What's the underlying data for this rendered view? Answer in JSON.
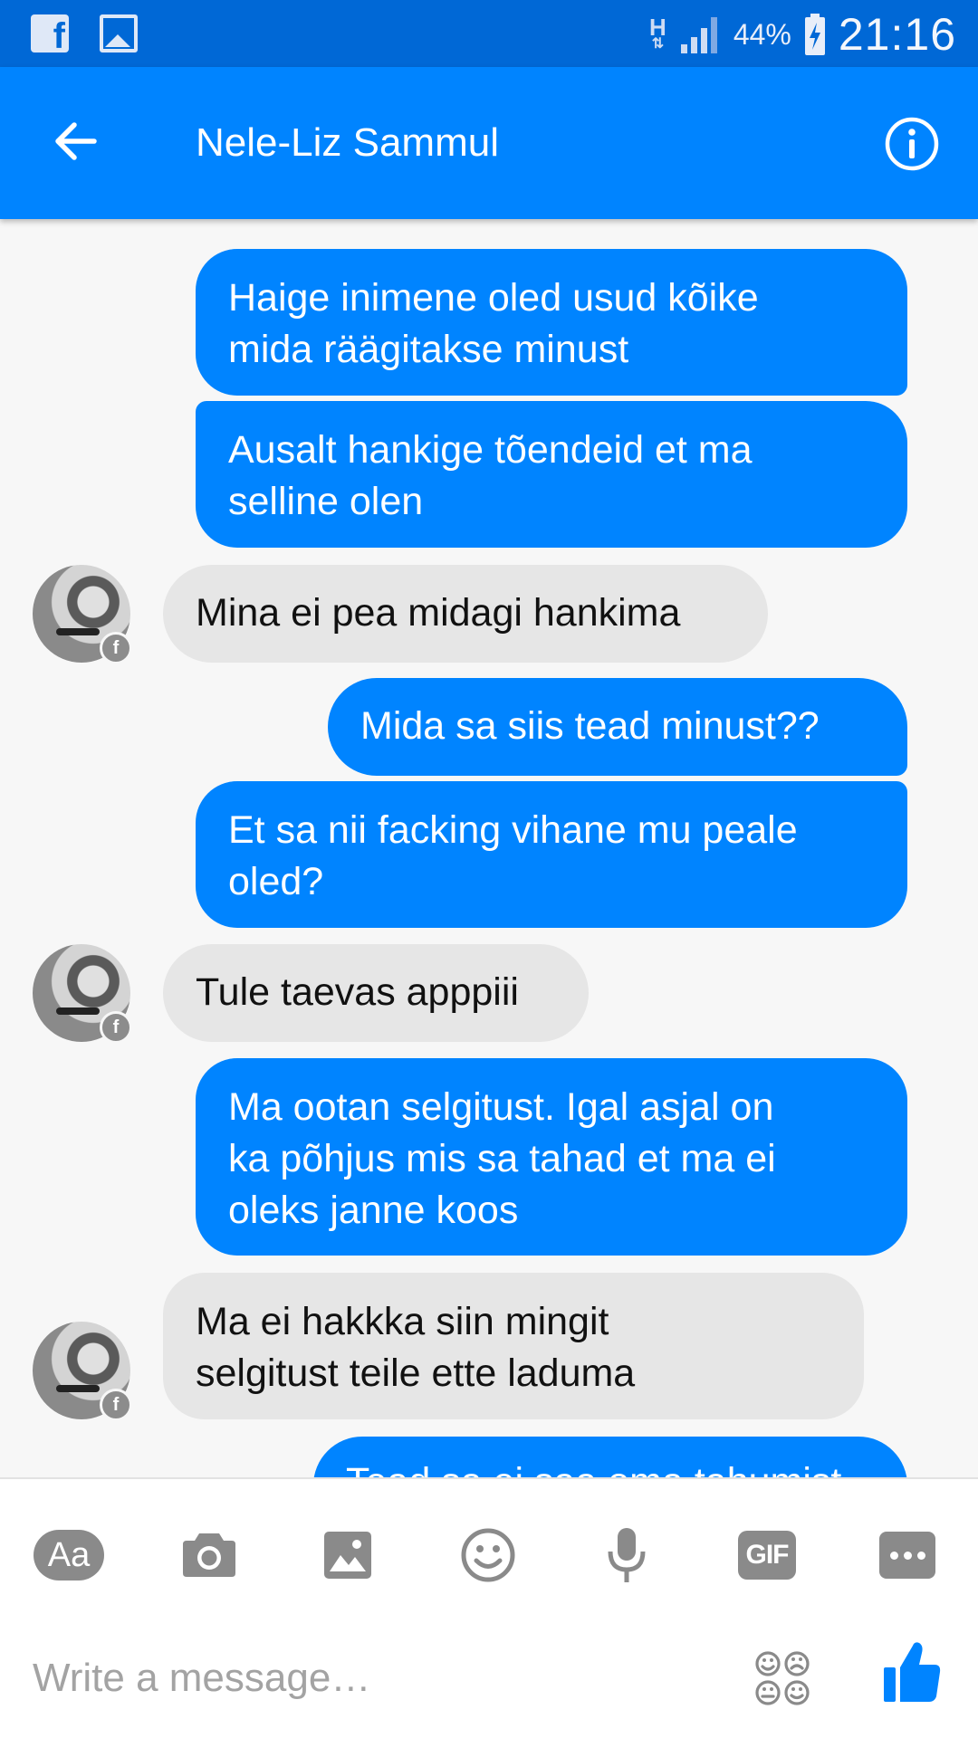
{
  "status_bar": {
    "network_type": "H",
    "battery_percent": "44%",
    "time": "21:16",
    "icons": [
      "facebook-notification-icon",
      "gallery-notification-icon",
      "network-h-icon",
      "signal-icon",
      "battery-charging-icon"
    ]
  },
  "header": {
    "title": "Nele-Liz Sammul",
    "back_icon": "arrow-left-icon",
    "info_icon": "info-circle-icon"
  },
  "messages": [
    {
      "direction": "outgoing",
      "text_lines": [
        "Haige inimene oled usud kõike",
        "mida räägitakse minust"
      ]
    },
    {
      "direction": "outgoing",
      "text_lines": [
        "Ausalt hankige tõendeid et ma",
        "selline olen"
      ]
    },
    {
      "direction": "incoming",
      "text_lines": [
        "Mina ei pea midagi hankima"
      ]
    },
    {
      "direction": "outgoing",
      "text_lines": [
        "Mida sa siis tead minust??"
      ]
    },
    {
      "direction": "outgoing",
      "text_lines": [
        "Et sa nii facking vihane mu peale",
        "oled?"
      ]
    },
    {
      "direction": "incoming",
      "text_lines": [
        "Tule taevas apppiii"
      ]
    },
    {
      "direction": "outgoing",
      "text_lines": [
        "Ma ootan selgitust. Igal asjal on",
        "ka põhjus mis sa tahad et ma ei",
        "oleks janne koos"
      ]
    },
    {
      "direction": "incoming",
      "text_lines": [
        "Ma ei hakkka siin mingit",
        "selgitust teile ette laduma"
      ]
    },
    {
      "direction": "outgoing",
      "text_lines": [
        "Tead sa ei saa oma tahumist"
      ]
    }
  ],
  "avatar_badge_glyph": "f",
  "composer": {
    "aa_label": "Aa",
    "gif_label": "GIF",
    "tools": [
      "text-format-icon",
      "camera-icon",
      "image-icon",
      "emoji-icon",
      "microphone-icon",
      "gif-icon",
      "more-icon"
    ],
    "placeholder": "Write a message…",
    "stickers_icon": "stickers-icon",
    "send_icon": "thumbs-up-icon"
  },
  "colors": {
    "status_bar": "#0068d6",
    "brand": "#0084ff",
    "incoming_bubble": "#e6e6e6",
    "background": "#f7f7f7",
    "tool_gray": "#8a8a8a"
  }
}
